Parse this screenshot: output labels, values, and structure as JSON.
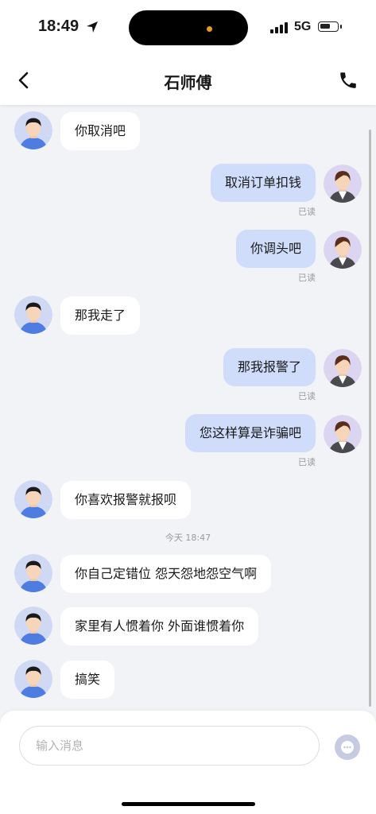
{
  "status_bar": {
    "time": "18:49",
    "network": "5G"
  },
  "header": {
    "title": "石师傅"
  },
  "messages": [
    {
      "text": "你取消吧"
    },
    {
      "text": "取消订单扣钱",
      "read": "已读"
    },
    {
      "text": "你调头吧",
      "read": "已读"
    },
    {
      "text": "那我走了"
    },
    {
      "text": "那我报警了",
      "read": "已读"
    },
    {
      "text": "您这样算是诈骗吧",
      "read": "已读"
    },
    {
      "text": "你喜欢报警就报呗"
    },
    {
      "text": "你自己定错位  怨天怨地怨空气啊"
    },
    {
      "text": "家里有人惯着你 外面谁惯着你"
    },
    {
      "text": "搞笑"
    }
  ],
  "timestamp": "今天 18:47",
  "composer": {
    "placeholder": "输入消息"
  },
  "colors": {
    "outgoing_bubble": "#cfddfb",
    "incoming_bubble": "#ffffff",
    "background": "#f2f3f7"
  }
}
